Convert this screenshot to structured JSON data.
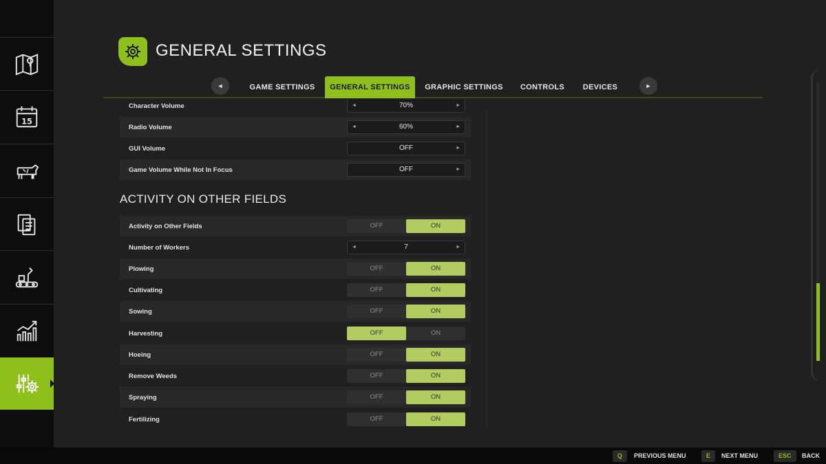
{
  "header": {
    "title": "GENERAL SETTINGS",
    "logo_icon": "gear-icon"
  },
  "tabs": [
    {
      "label": "GAME SETTINGS",
      "active": false
    },
    {
      "label": "GENERAL SETTINGS",
      "active": true
    },
    {
      "label": "GRAPHIC SETTINGS",
      "active": false
    },
    {
      "label": "CONTROLS",
      "active": false
    },
    {
      "label": "DEVICES",
      "active": false
    }
  ],
  "tab_arrows": {
    "prev": "◄",
    "next": "►"
  },
  "sidebar": {
    "items": [
      {
        "icon": "map-icon"
      },
      {
        "icon": "calendar-icon",
        "text": "15"
      },
      {
        "icon": "cow-icon"
      },
      {
        "icon": "contracts-icon"
      },
      {
        "icon": "production-icon"
      },
      {
        "icon": "statistics-icon"
      },
      {
        "icon": "settings-icon",
        "active": true
      }
    ]
  },
  "audio": {
    "rows": [
      {
        "label": "Character Volume",
        "value": "70%"
      },
      {
        "label": "Radio Volume",
        "value": "60%"
      },
      {
        "label": "GUI Volume",
        "value": "OFF"
      },
      {
        "label": "Game Volume While Not In Focus",
        "value": "OFF"
      }
    ]
  },
  "activity": {
    "title": "ACTIVITY ON OTHER FIELDS",
    "off_label": "OFF",
    "on_label": "ON",
    "rows": [
      {
        "label": "Activity on Other Fields",
        "type": "toggle",
        "on": true
      },
      {
        "label": "Number of Workers",
        "type": "selector",
        "value": "7"
      },
      {
        "label": "Plowing",
        "type": "toggle",
        "on": true
      },
      {
        "label": "Cultivating",
        "type": "toggle",
        "on": true
      },
      {
        "label": "Sowing",
        "type": "toggle",
        "on": true
      },
      {
        "label": "Harvesting",
        "type": "toggle",
        "on": false
      },
      {
        "label": "Hoeing",
        "type": "toggle",
        "on": true
      },
      {
        "label": "Remove Weeds",
        "type": "toggle",
        "on": true
      },
      {
        "label": "Spraying",
        "type": "toggle",
        "on": true
      },
      {
        "label": "Fertilizing",
        "type": "toggle",
        "on": true
      }
    ]
  },
  "footer": {
    "buttons": [
      {
        "key": "Q",
        "label": "PREVIOUS MENU"
      },
      {
        "key": "E",
        "label": "NEXT MENU"
      },
      {
        "key": "ESC",
        "label": "BACK"
      }
    ]
  },
  "colors": {
    "accent": "#8fbf1a",
    "toggle_selected": "#b3cc60",
    "background": "#202020",
    "sidebar": "#0d0d0d"
  }
}
